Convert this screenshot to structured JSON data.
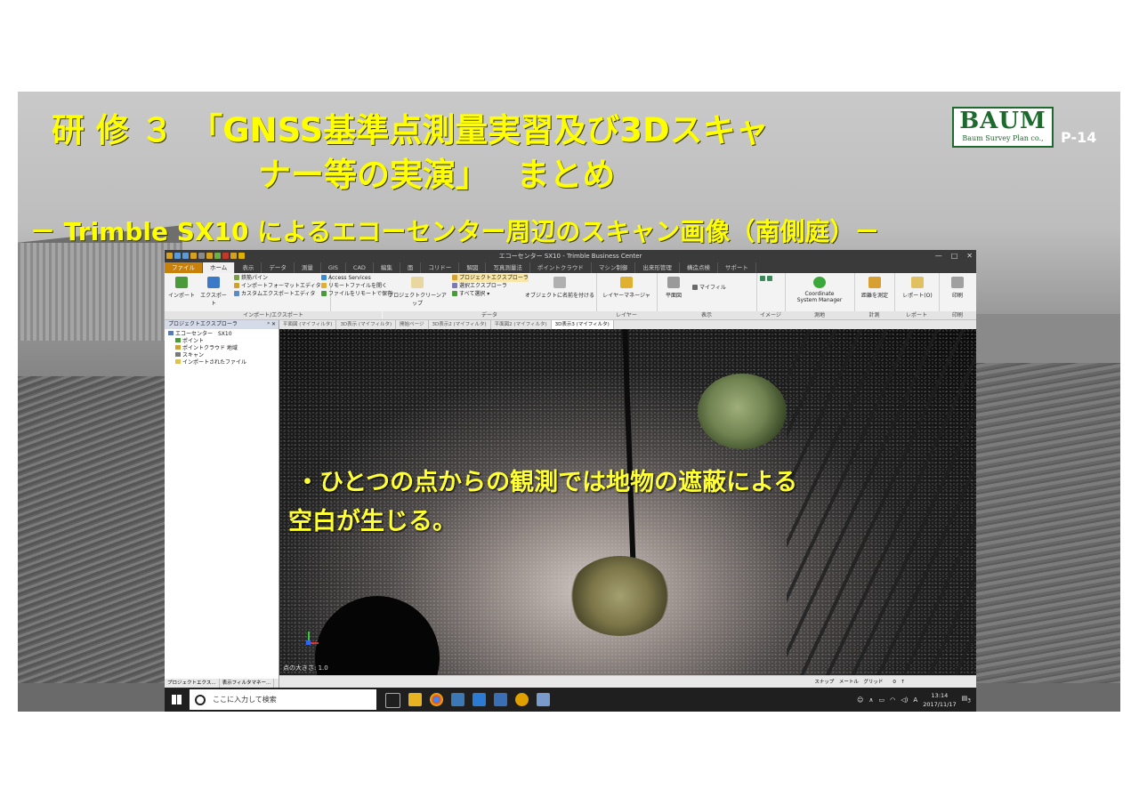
{
  "slide": {
    "title_line1": "研 修 ３　「GNSS基準点測量実習及び3Dスキャ",
    "title_line2": "ナー等の実演」　 まとめ",
    "subtitle": "－ Trimble SX10 によるエコーセンター周辺のスキャン画像（南側庭）－",
    "logo_main": "BAUM",
    "logo_sub": "Baum Survey Plan co.,",
    "page_number": "P-14"
  },
  "app": {
    "window_title": "エコーセンター SX10 - Trimble Business Center",
    "window_controls": [
      "—",
      "□",
      "✕"
    ],
    "tabs": [
      "ファイル",
      "ホーム",
      "表示",
      "データ",
      "測量",
      "GIS",
      "CAD",
      "編集",
      "面",
      "コリドー",
      "解図",
      "写真測量法",
      "ポイントクラウド",
      "マシン制御",
      "出来形管理",
      "構造点検",
      "サポート"
    ],
    "active_tab_index": 1,
    "ribbon": {
      "import_export": {
        "label": "インポート/エクスポート",
        "import": "インポート",
        "export": "エクスポート",
        "items": [
          "鉄筋パイン",
          "インポートフォーマットエディタ",
          "カスタムエクスポートエディタ",
          "Access Services",
          "リモートファイルを開く",
          "ファイルをリモートで保存"
        ]
      },
      "data": {
        "label": "データ",
        "cleanup": "プロジェクトクリーンアップ",
        "items": [
          "プロジェクトエクスプローラ",
          "選択エクスプローラ",
          "すべて選択 ▾"
        ],
        "name_objects": "オブジェクトに名前を付ける"
      },
      "layer": {
        "label": "レイヤー",
        "manager": "レイヤーマネージャ"
      },
      "view": {
        "label": "表示",
        "plan": "平面図",
        "filter": "マイフィル"
      },
      "image": {
        "label": "イメージ"
      },
      "survey": {
        "label": "測地",
        "coord_line1": "Coordinate",
        "coord_line2": "System Manager"
      },
      "calc": {
        "label": "計測",
        "btn": "距離を測定"
      },
      "report": {
        "label": "レポート",
        "btn": "レポート(O)"
      },
      "print": {
        "label": "印刷",
        "btn": "印刷"
      }
    },
    "explorer": {
      "title": "プロジェクトエクスプローラ",
      "pin": "ᵖ ✕",
      "root": "エコーセンター　SX10",
      "items": [
        "ポイント",
        "ポイントクラウド 地域",
        "スキャン",
        "インポートされたファイル"
      ],
      "footer_tabs": [
        "プロジェクトエクス...",
        "表示フィルタマネー..."
      ]
    },
    "view_tabs": [
      "平面図 (マイフィルタ)",
      "3D表示 (マイフィルタ)",
      "開始ページ",
      "3D表示2 (マイフィルタ)",
      "平面図2 (マイフィルタ)",
      "3D表示3 (マイフィルタ)"
    ],
    "active_view_tab": 5,
    "viewport": {
      "note_line1": "・ひとつの点からの観測では地物の遮蔽による",
      "note_line2": "空白が生じる。",
      "point_size": "点の大きさ: 1.0"
    },
    "statusbar": "スナップ　メートル　グリッド　　0　↑"
  },
  "taskbar": {
    "search_placeholder": "ここに入力して検索",
    "time": "13:14",
    "date": "2017/11/17",
    "ime": "A",
    "notification_count": "3",
    "icon_colors": [
      "#4aa3df",
      "#e8b321",
      "#db4437",
      "#3b78b5",
      "#2b7bd4",
      "#3a6fb5",
      "#e0a000",
      "#7a9acb"
    ]
  },
  "colors": {
    "title_yellow": "#ffff00",
    "logo_green": "#1e6a2e",
    "file_tab_orange": "#c8820a"
  }
}
